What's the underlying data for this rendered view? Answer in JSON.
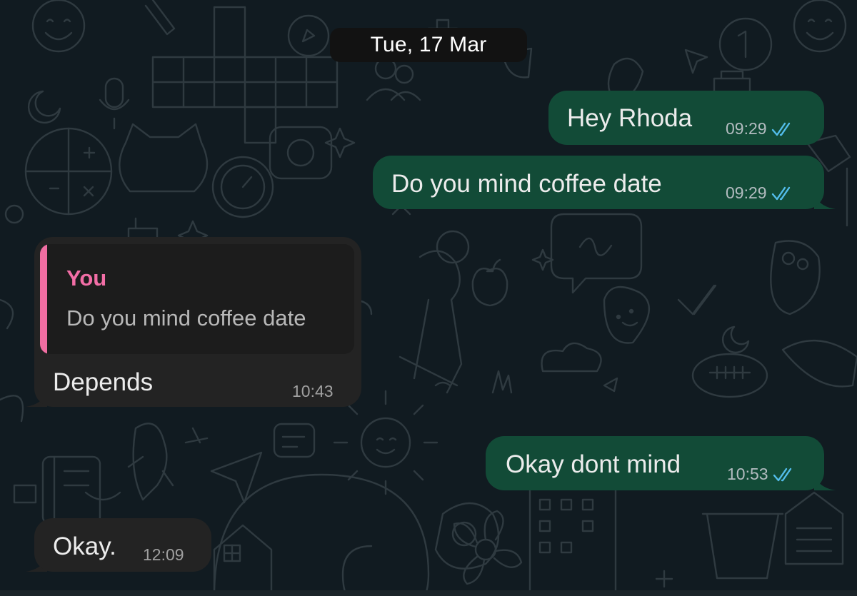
{
  "date_separator": "Tue, 17 Mar",
  "colors": {
    "outgoing_bubble": "#124b37",
    "incoming_bubble": "#232323",
    "read_ticks": "#53bdeb",
    "reply_accent": "#f26ea6",
    "wallpaper_bg": "#111b21"
  },
  "messages": [
    {
      "direction": "outgoing",
      "text": "Hey Rhoda",
      "time": "09:29",
      "status_icon": "double-check-read-icon"
    },
    {
      "direction": "outgoing",
      "text": "Do you mind coffee date",
      "time": "09:29",
      "status_icon": "double-check-read-icon"
    },
    {
      "direction": "incoming",
      "reply_to": {
        "author": "You",
        "text": "Do you mind coffee date"
      },
      "text": "Depends",
      "time": "10:43"
    },
    {
      "direction": "outgoing",
      "text": "Okay dont mind",
      "time": "10:53",
      "status_icon": "double-check-read-icon"
    },
    {
      "direction": "incoming",
      "text": "Okay.",
      "time": "12:09"
    }
  ]
}
